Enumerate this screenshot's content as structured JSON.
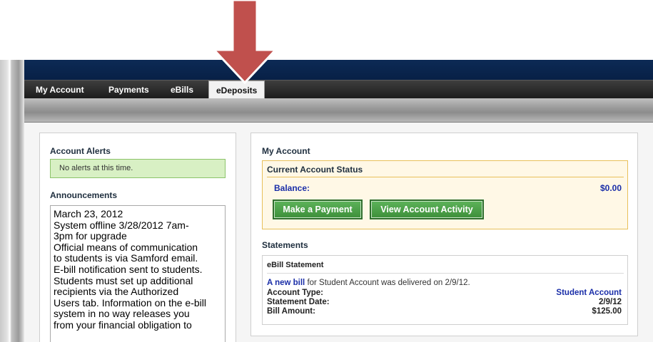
{
  "nav": {
    "items": [
      {
        "label": "My Account"
      },
      {
        "label": "Payments"
      },
      {
        "label": "eBills"
      },
      {
        "label": "eDeposits"
      }
    ],
    "active_index": 3
  },
  "left": {
    "alerts_title": "Account Alerts",
    "alert_text": "No alerts at this time.",
    "announcements_title": "Announcements",
    "announcement_lines": [
      "March 23, 2012",
      "System offline 3/28/2012 7am-",
      "3pm for upgrade",
      "Official means of communication",
      "to students is via Samford email.",
      "E-bill notification sent to students.",
      "Students must set up additional",
      "recipients via the Authorized",
      "Users tab. Information on the e-bill",
      "system in no way releases you",
      "from your financial obligation to"
    ]
  },
  "account": {
    "title": "My Account",
    "status_title": "Current Account Status",
    "balance_label": "Balance:",
    "balance_value": "$0.00",
    "make_payment_label": "Make a Payment",
    "view_activity_label": "View Account Activity"
  },
  "statements": {
    "title": "Statements",
    "ebill_heading": "eBill Statement",
    "new_bill_link": "A new bill",
    "new_bill_text": " for Student Account was delivered on 2/9/12.",
    "rows": [
      {
        "label": "Account Type:",
        "value": "Student Account"
      },
      {
        "label": "Statement Date:",
        "value": "2/9/12"
      },
      {
        "label": "Bill Amount:",
        "value": "$125.00"
      }
    ]
  },
  "colors": {
    "header_navy": "#082046",
    "link_blue": "#1a2ea8",
    "button_green": "#3d8f3a",
    "arrow_red": "#c0504d"
  },
  "icons": {
    "arrow": "down-arrow-icon"
  }
}
